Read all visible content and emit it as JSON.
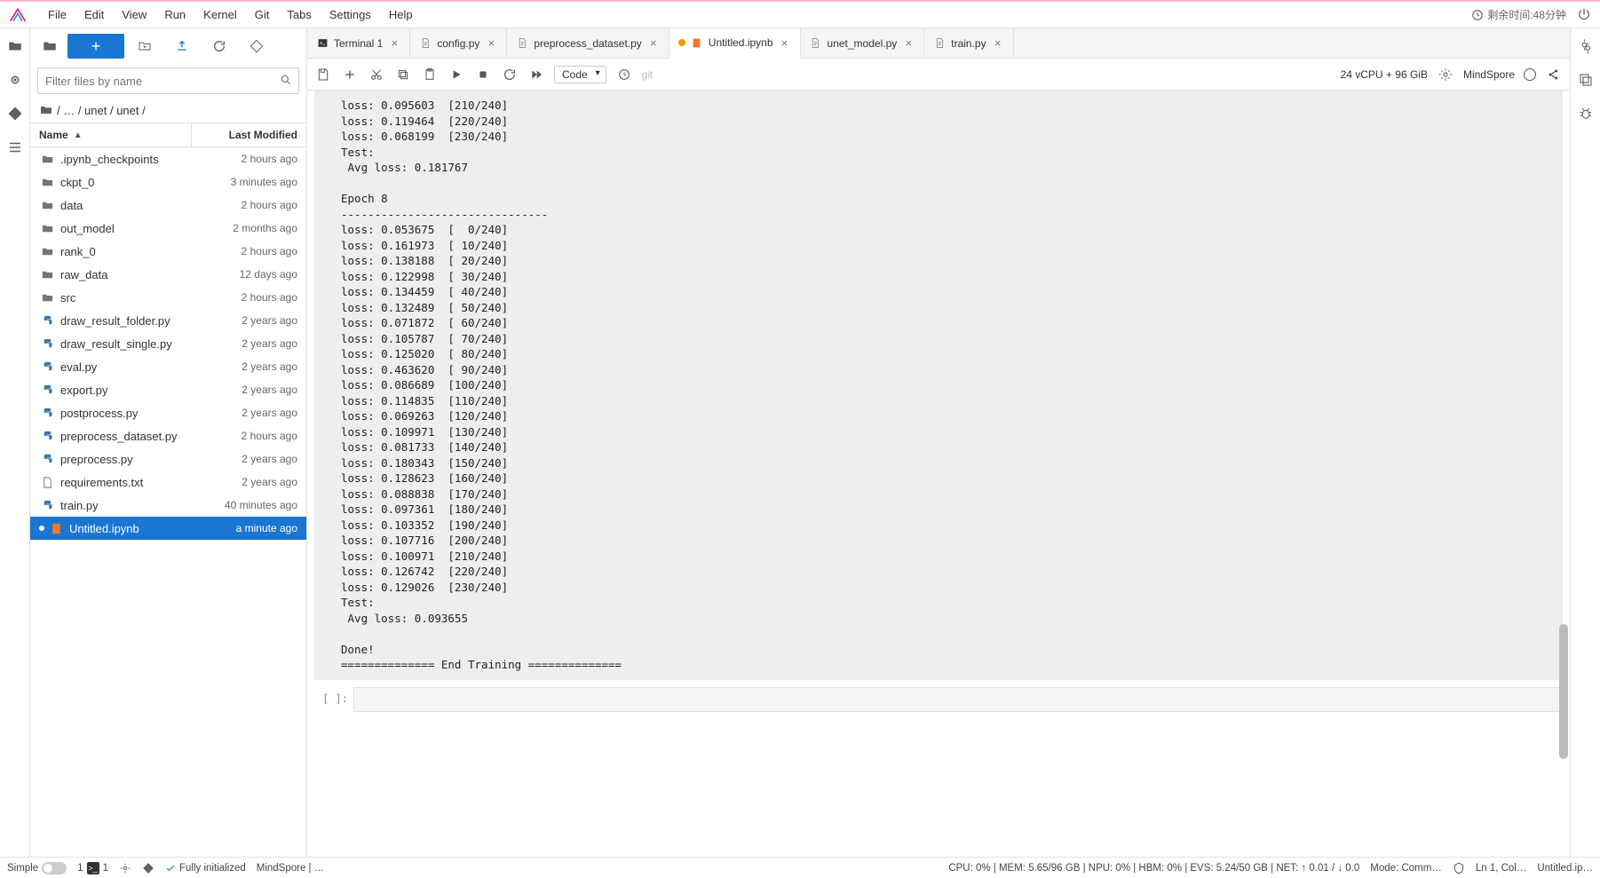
{
  "menubar": {
    "items": [
      "File",
      "Edit",
      "View",
      "Run",
      "Kernel",
      "Git",
      "Tabs",
      "Settings",
      "Help"
    ],
    "remaining_time_label": "剩余时间:48分钟"
  },
  "sidebar": {
    "filter_placeholder": "Filter files by name",
    "breadcrumb": [
      "/",
      "…",
      "/",
      "unet",
      "/",
      "unet",
      "/"
    ],
    "header": {
      "name": "Name",
      "modified": "Last Modified"
    },
    "files": [
      {
        "icon": "folder",
        "name": ".ipynb_checkpoints",
        "mod": "2 hours ago"
      },
      {
        "icon": "folder",
        "name": "ckpt_0",
        "mod": "3 minutes ago"
      },
      {
        "icon": "folder",
        "name": "data",
        "mod": "2 hours ago"
      },
      {
        "icon": "folder",
        "name": "out_model",
        "mod": "2 months ago"
      },
      {
        "icon": "folder",
        "name": "rank_0",
        "mod": "2 hours ago"
      },
      {
        "icon": "folder",
        "name": "raw_data",
        "mod": "12 days ago"
      },
      {
        "icon": "folder",
        "name": "src",
        "mod": "2 hours ago"
      },
      {
        "icon": "python",
        "name": "draw_result_folder.py",
        "mod": "2 years ago"
      },
      {
        "icon": "python",
        "name": "draw_result_single.py",
        "mod": "2 years ago"
      },
      {
        "icon": "python",
        "name": "eval.py",
        "mod": "2 years ago"
      },
      {
        "icon": "python",
        "name": "export.py",
        "mod": "2 years ago"
      },
      {
        "icon": "python",
        "name": "postprocess.py",
        "mod": "2 years ago"
      },
      {
        "icon": "python",
        "name": "preprocess_dataset.py",
        "mod": "2 hours ago"
      },
      {
        "icon": "python",
        "name": "preprocess.py",
        "mod": "2 years ago"
      },
      {
        "icon": "file",
        "name": "requirements.txt",
        "mod": "2 years ago"
      },
      {
        "icon": "python",
        "name": "train.py",
        "mod": "40 minutes ago"
      },
      {
        "icon": "notebook",
        "name": "Untitled.ipynb",
        "mod": "a minute ago",
        "selected": true,
        "running": true
      }
    ]
  },
  "tabs": [
    {
      "icon": "terminal",
      "label": "Terminal 1",
      "active": false
    },
    {
      "icon": "text",
      "label": "config.py",
      "active": false
    },
    {
      "icon": "text",
      "label": "preprocess_dataset.py",
      "active": false
    },
    {
      "icon": "notebook",
      "label": "Untitled.ipynb",
      "active": true,
      "dirty": true
    },
    {
      "icon": "text",
      "label": "unet_model.py",
      "active": false
    },
    {
      "icon": "text",
      "label": "train.py",
      "active": false
    }
  ],
  "nb_toolbar": {
    "cell_type": "Code",
    "git": "git",
    "cpu_info": "24 vCPU + 96 GiB",
    "kernel": "MindSpore"
  },
  "output": "loss: 0.095603  [210/240]\nloss: 0.119464  [220/240]\nloss: 0.068199  [230/240]\nTest:\n Avg loss: 0.181767\n\nEpoch 8\n-------------------------------\nloss: 0.053675  [  0/240]\nloss: 0.161973  [ 10/240]\nloss: 0.138188  [ 20/240]\nloss: 0.122998  [ 30/240]\nloss: 0.134459  [ 40/240]\nloss: 0.132489  [ 50/240]\nloss: 0.071872  [ 60/240]\nloss: 0.105787  [ 70/240]\nloss: 0.125020  [ 80/240]\nloss: 0.463620  [ 90/240]\nloss: 0.086689  [100/240]\nloss: 0.114835  [110/240]\nloss: 0.069263  [120/240]\nloss: 0.109971  [130/240]\nloss: 0.081733  [140/240]\nloss: 0.180343  [150/240]\nloss: 0.128623  [160/240]\nloss: 0.088838  [170/240]\nloss: 0.097361  [180/240]\nloss: 0.103352  [190/240]\nloss: 0.107716  [200/240]\nloss: 0.100971  [210/240]\nloss: 0.126742  [220/240]\nloss: 0.129026  [230/240]\nTest:\n Avg loss: 0.093655\n\nDone!\n============== End Training ==============",
  "cell_prompt": "[ ]:",
  "statusbar": {
    "simple": "Simple",
    "term_count": "1",
    "term2_count": "1",
    "init": "Fully initialized",
    "ms": "MindSpore | …",
    "metrics": "CPU: 0%  |  MEM: 5.65/96 GB  |  NPU: 0%  |  HBM: 0%  |  EVS: 5.24/50 GB  |  NET: ↑ 0.01 / ↓ 0.0",
    "mode": "Mode: Comm…",
    "lncol": "Ln 1, Col…",
    "file": "Untitled.ip…"
  }
}
